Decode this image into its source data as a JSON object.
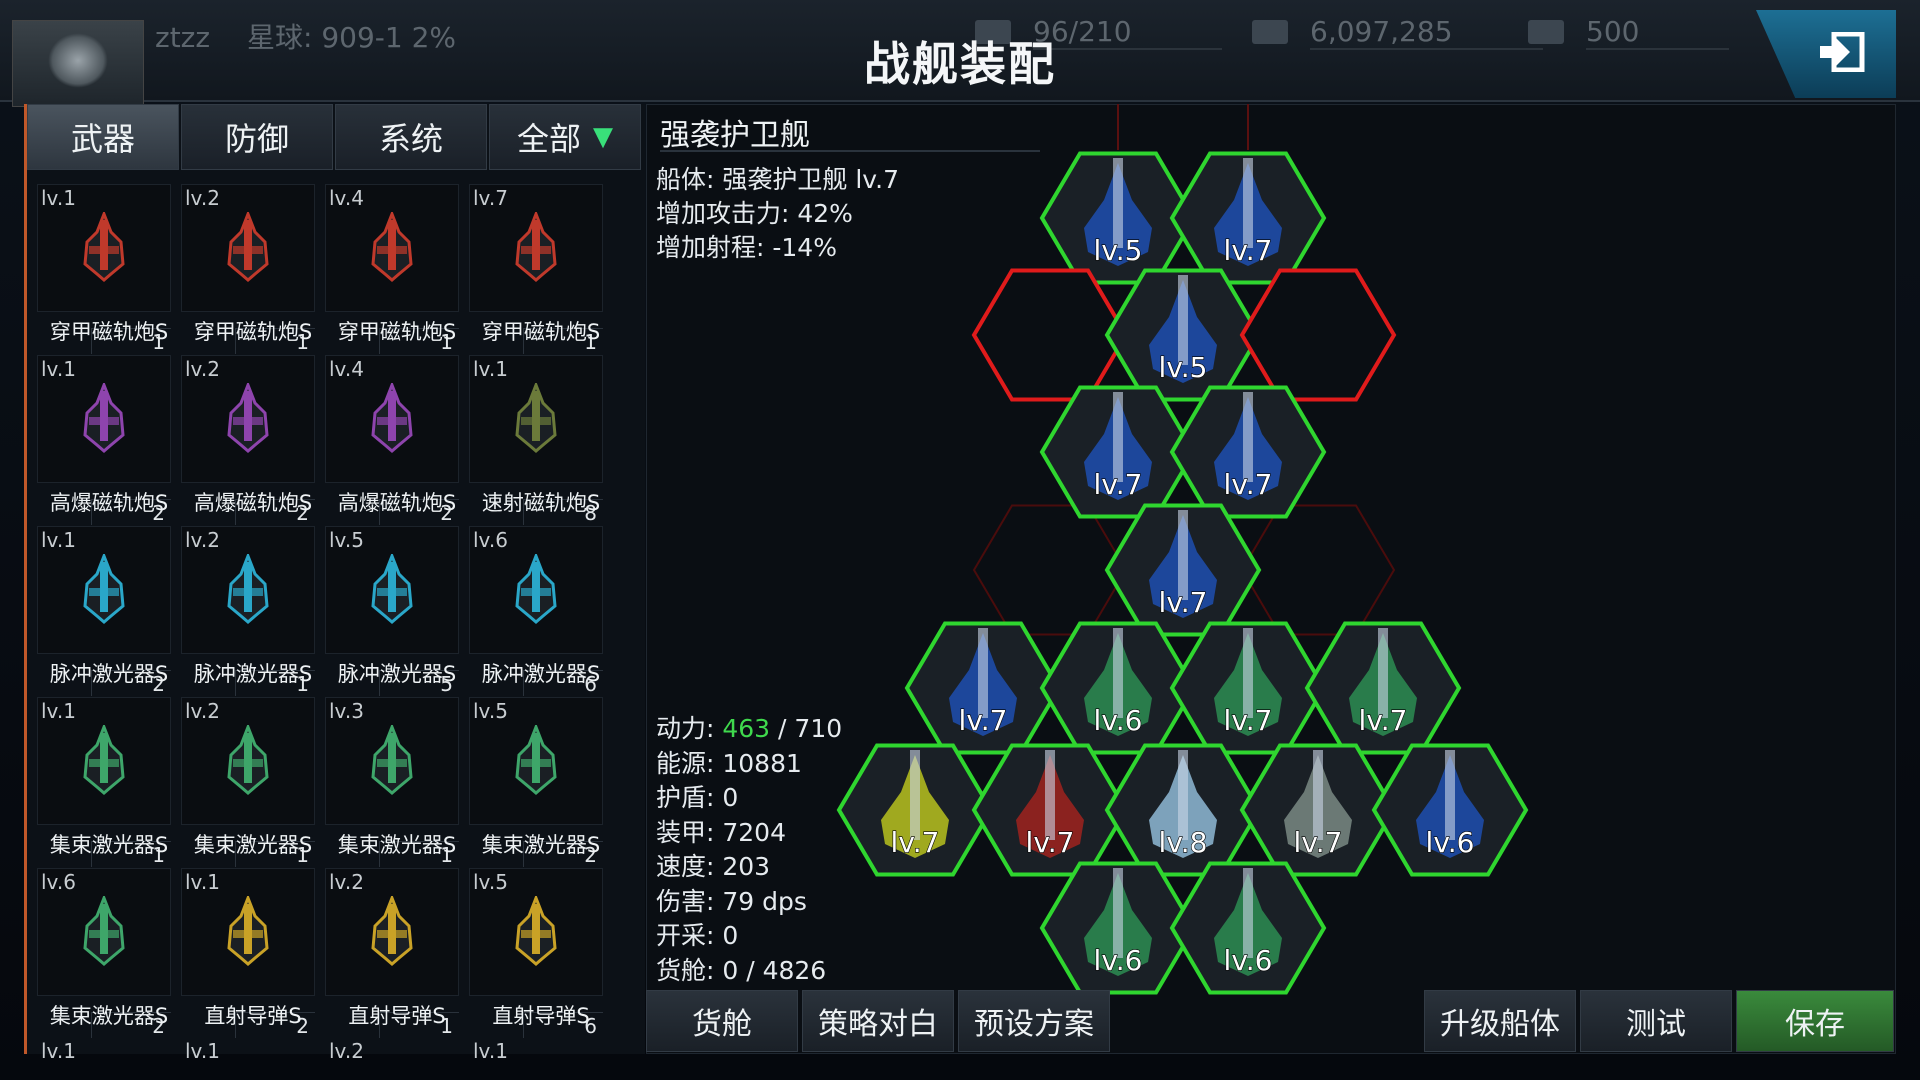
{
  "header": {
    "title": "战舰装配",
    "player_name": "ztzz",
    "planet": "星球: 909-1 2%",
    "fleet": "96/210",
    "credits": "6,097,285",
    "crystals": "500"
  },
  "tabs": [
    {
      "label": "武器",
      "active": true
    },
    {
      "label": "防御",
      "active": false
    },
    {
      "label": "系统",
      "active": false
    },
    {
      "label": "全部",
      "active": false,
      "dropdown": true
    }
  ],
  "modules": [
    {
      "level": "lv.1",
      "count": "1",
      "name": "穿甲磁轨炮S",
      "color": "#c0392b"
    },
    {
      "level": "lv.2",
      "count": "1",
      "name": "穿甲磁轨炮S",
      "color": "#c0392b"
    },
    {
      "level": "lv.4",
      "count": "1",
      "name": "穿甲磁轨炮S",
      "color": "#c0392b"
    },
    {
      "level": "lv.7",
      "count": "1",
      "name": "穿甲磁轨炮S",
      "color": "#c0392b"
    },
    {
      "level": "lv.1",
      "count": "2",
      "name": "高爆磁轨炮S",
      "color": "#8e44ad"
    },
    {
      "level": "lv.2",
      "count": "2",
      "name": "高爆磁轨炮S",
      "color": "#8e44ad"
    },
    {
      "level": "lv.4",
      "count": "2",
      "name": "高爆磁轨炮S",
      "color": "#8e44ad"
    },
    {
      "level": "lv.1",
      "count": "8",
      "name": "速射磁轨炮S",
      "color": "#6b7a3a"
    },
    {
      "level": "lv.1",
      "count": "2",
      "name": "脉冲激光器S",
      "color": "#2aa7c9"
    },
    {
      "level": "lv.2",
      "count": "1",
      "name": "脉冲激光器S",
      "color": "#2aa7c9"
    },
    {
      "level": "lv.5",
      "count": "5",
      "name": "脉冲激光器S",
      "color": "#2aa7c9"
    },
    {
      "level": "lv.6",
      "count": "6",
      "name": "脉冲激光器S",
      "color": "#2aa7c9"
    },
    {
      "level": "lv.1",
      "count": "1",
      "name": "集束激光器S",
      "color": "#3ea66a"
    },
    {
      "level": "lv.2",
      "count": "1",
      "name": "集束激光器S",
      "color": "#3ea66a"
    },
    {
      "level": "lv.3",
      "count": "1",
      "name": "集束激光器S",
      "color": "#3ea66a"
    },
    {
      "level": "lv.5",
      "count": "2",
      "name": "集束激光器S",
      "color": "#3ea66a"
    },
    {
      "level": "lv.6",
      "count": "2",
      "name": "集束激光器S",
      "color": "#3ea66a"
    },
    {
      "level": "lv.1",
      "count": "2",
      "name": "直射导弹S",
      "color": "#c9a227"
    },
    {
      "level": "lv.2",
      "count": "1",
      "name": "直射导弹S",
      "color": "#c9a227"
    },
    {
      "level": "lv.5",
      "count": "6",
      "name": "直射导弹S",
      "color": "#c9a227"
    }
  ],
  "modules_partial_row": [
    "lv.1",
    "lv.1",
    "lv.2",
    "lv.1"
  ],
  "ship": {
    "name": "强袭护卫舰",
    "hull": "船体: 强袭护卫舰 lv.7",
    "attack_bonus": "增加攻击力: 42%",
    "range_bonus": "增加射程: -14%"
  },
  "stats": {
    "power_label": "动力: ",
    "power_used": "463",
    "power_total": " / 710",
    "energy": "能源: 10881",
    "shield": "护盾: 0",
    "armor": "装甲: 7204",
    "speed": "速度: 203",
    "damage": "伤害: 79 dps",
    "mining": "开采: 0",
    "cargo": "货舱: 0 / 4826"
  },
  "slots": [
    {
      "label": "lv.5",
      "kind": "blue"
    },
    {
      "label": "lv.7",
      "kind": "blue"
    },
    {
      "label": "",
      "kind": "empty"
    },
    {
      "label": "lv.5",
      "kind": "blue"
    },
    {
      "label": "",
      "kind": "empty"
    },
    {
      "label": "lv.7",
      "kind": "blue"
    },
    {
      "label": "lv.7",
      "kind": "blue"
    },
    {
      "label": "lv.7",
      "kind": "blue"
    },
    {
      "label": "lv.7",
      "kind": "blue"
    },
    {
      "label": "lv.6",
      "kind": "green"
    },
    {
      "label": "lv.7",
      "kind": "green"
    },
    {
      "label": "lv.7",
      "kind": "green"
    },
    {
      "label": "lv.7",
      "kind": "yellow"
    },
    {
      "label": "lv.7",
      "kind": "red"
    },
    {
      "label": "lv.8",
      "kind": "white"
    },
    {
      "label": "lv.7",
      "kind": "gray"
    },
    {
      "label": "lv.6",
      "kind": "blue"
    },
    {
      "label": "lv.6",
      "kind": "green"
    },
    {
      "label": "lv.6",
      "kind": "green"
    }
  ],
  "buttons": {
    "cargo": "货舱",
    "strategy": "策略对白",
    "preset": "预设方案",
    "upgrade": "升级船体",
    "test": "测试",
    "save": "保存"
  },
  "colors": {
    "slot_filled": "#2fd62f",
    "slot_empty": "#e01b1b",
    "accent_green": "#3fd94d"
  }
}
